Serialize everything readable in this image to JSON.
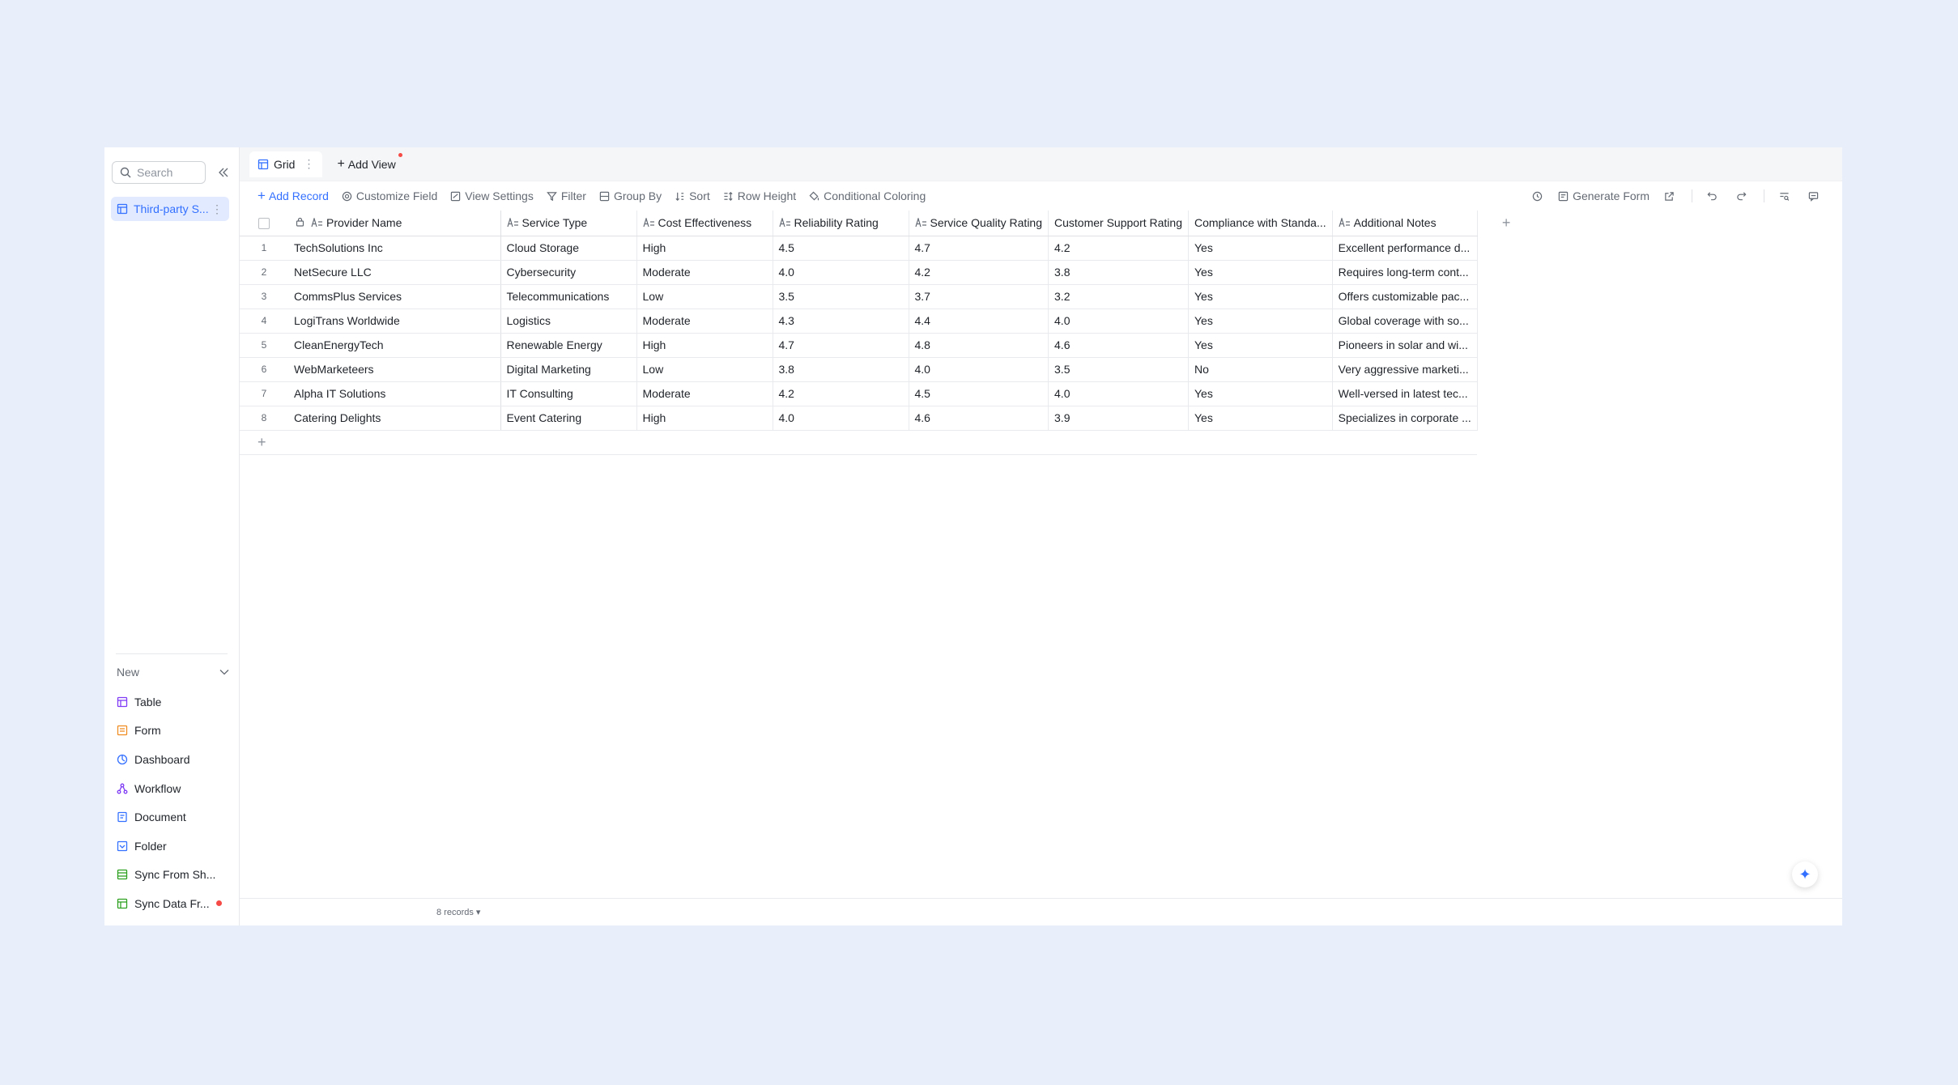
{
  "sidebar": {
    "search_placeholder": "Search",
    "table_name": "Third-party S...",
    "new_label": "New",
    "new_items": [
      {
        "label": "Table",
        "icon": "table-icon",
        "color": "#7f3bf5"
      },
      {
        "label": "Form",
        "icon": "form-icon",
        "color": "#f08d22"
      },
      {
        "label": "Dashboard",
        "icon": "dashboard-icon",
        "color": "#3370ff"
      },
      {
        "label": "Workflow",
        "icon": "workflow-icon",
        "color": "#7f3bf5"
      },
      {
        "label": "Document",
        "icon": "document-icon",
        "color": "#3370ff"
      },
      {
        "label": "Folder",
        "icon": "folder-icon",
        "color": "#3370ff"
      },
      {
        "label": "Sync From Sh...",
        "icon": "sync-icon",
        "color": "#2ea121"
      },
      {
        "label": "Sync Data Fr...",
        "icon": "sync-data-icon",
        "color": "#2ea121"
      }
    ]
  },
  "tabs": {
    "grid": "Grid",
    "add_view": "Add View"
  },
  "toolbar": {
    "add_record": "Add Record",
    "customize_field": "Customize Field",
    "view_settings": "View Settings",
    "filter": "Filter",
    "group_by": "Group By",
    "sort": "Sort",
    "row_height": "Row Height",
    "conditional_coloring": "Conditional Coloring",
    "generate_form": "Generate Form"
  },
  "columns": [
    "Provider Name",
    "Service Type",
    "Cost Effectiveness",
    "Reliability Rating",
    "Service Quality Rating",
    "Customer Support Rating",
    "Compliance with Standa...",
    "Additional Notes"
  ],
  "rows": [
    {
      "idx": "1",
      "cells": [
        "TechSolutions Inc",
        "Cloud Storage",
        "High",
        "4.5",
        "4.7",
        "4.2",
        "Yes",
        "Excellent performance d..."
      ]
    },
    {
      "idx": "2",
      "cells": [
        "NetSecure LLC",
        "Cybersecurity",
        "Moderate",
        "4.0",
        "4.2",
        "3.8",
        "Yes",
        "Requires long-term cont..."
      ]
    },
    {
      "idx": "3",
      "cells": [
        "CommsPlus Services",
        "Telecommunications",
        "Low",
        "3.5",
        "3.7",
        "3.2",
        "Yes",
        "Offers customizable pac..."
      ]
    },
    {
      "idx": "4",
      "cells": [
        "LogiTrans Worldwide",
        "Logistics",
        "Moderate",
        "4.3",
        "4.4",
        "4.0",
        "Yes",
        "Global coverage with so..."
      ]
    },
    {
      "idx": "5",
      "cells": [
        "CleanEnergyTech",
        "Renewable Energy",
        "High",
        "4.7",
        "4.8",
        "4.6",
        "Yes",
        "Pioneers in solar and wi..."
      ]
    },
    {
      "idx": "6",
      "cells": [
        "WebMarketeers",
        "Digital Marketing",
        "Low",
        "3.8",
        "4.0",
        "3.5",
        "No",
        "Very aggressive marketi..."
      ]
    },
    {
      "idx": "7",
      "cells": [
        "Alpha IT Solutions",
        "IT Consulting",
        "Moderate",
        "4.2",
        "4.5",
        "4.0",
        "Yes",
        "Well-versed in latest tec..."
      ]
    },
    {
      "idx": "8",
      "cells": [
        "Catering Delights",
        "Event Catering",
        "High",
        "4.0",
        "4.6",
        "3.9",
        "Yes",
        "Specializes in corporate ..."
      ]
    }
  ],
  "footer": {
    "record_count": "8 records"
  }
}
